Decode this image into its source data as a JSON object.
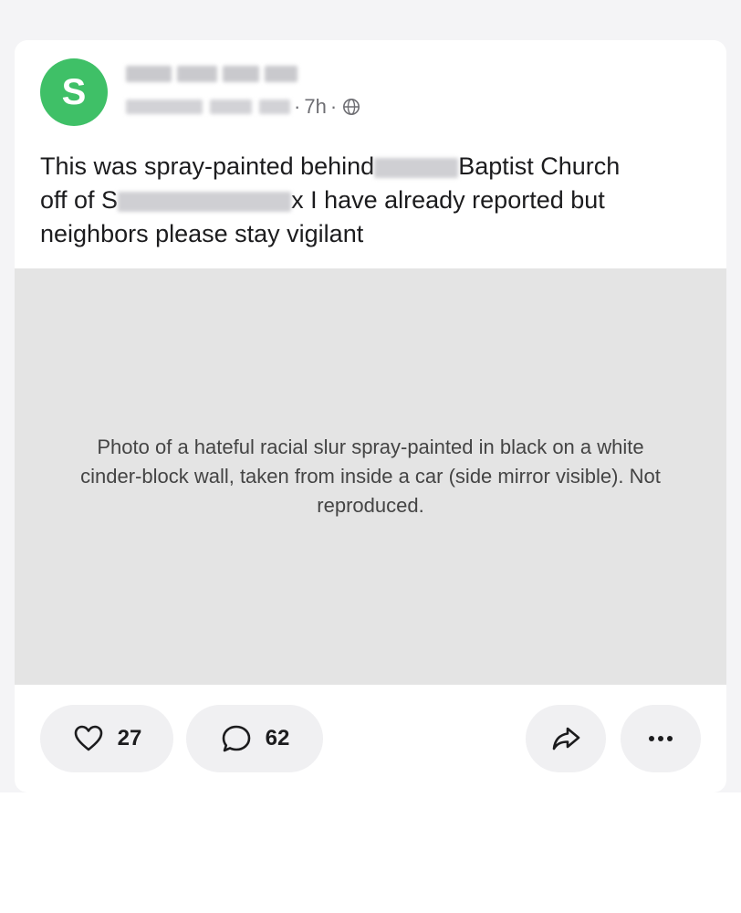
{
  "post": {
    "avatar_letter": "S",
    "avatar_color": "#3fc067",
    "time": "7h",
    "dot": "·",
    "text_parts": [
      "This was spray-painted behind",
      "Baptist Church",
      "off of S",
      "x I have already reported but",
      "neighbors please stay vigilant"
    ]
  },
  "image": {
    "placeholder_text": "Photo of a hateful racial slur spray-painted in black on a white cinder-block wall, taken from inside a car (side mirror visible). Not reproduced."
  },
  "actions": {
    "like_count": "27",
    "comment_count": "62"
  },
  "icons": {
    "globe": "globe-icon",
    "like": "heart-icon",
    "comment": "comment-bubble-icon",
    "share": "share-arrow-icon",
    "more": "more-dots-icon"
  }
}
